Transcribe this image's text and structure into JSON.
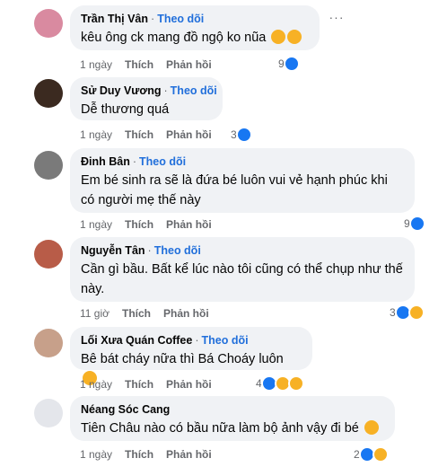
{
  "comments": [
    {
      "name": "Trần Thị Vân",
      "follow": "Theo dõi",
      "text": "kêu ông ck mang đồ ngộ ko nũa",
      "time": "1 ngày",
      "like": "Thích",
      "reply": "Phản hồi",
      "reaction_count": "9",
      "reactions": [
        "like-icon"
      ],
      "text_emojis": [
        "laughing-emoji",
        "laughing-emoji"
      ],
      "avatar_color": "#d98aa0"
    },
    {
      "name": "Sử Duy Vương",
      "follow": "Theo dõi",
      "text": "Dễ thương quá",
      "time": "1 ngày",
      "like": "Thích",
      "reply": "Phản hồi",
      "reaction_count": "3",
      "reactions": [
        "like-icon"
      ],
      "avatar_color": "#3b2a20"
    },
    {
      "name": "Đinh Bân",
      "follow": "Theo dõi",
      "text": "Em bé sinh ra sẽ là đứa bé luôn vui vẻ hạnh phúc khi có người mẹ thế này",
      "time": "1 ngày",
      "like": "Thích",
      "reply": "Phản hồi",
      "reaction_count": "9",
      "reactions": [
        "like-icon"
      ],
      "avatar_color": "#7a7a7a"
    },
    {
      "name": "Nguyễn Tân",
      "follow": "Theo dõi",
      "text": "Cần gì bầu. Bất kể lúc nào tôi cũng có thể chụp như thế này.",
      "time": "11 giờ",
      "like": "Thích",
      "reply": "Phản hồi",
      "reaction_count": "3",
      "reactions": [
        "like-icon",
        "haha-icon"
      ],
      "avatar_color": "#b85c48"
    },
    {
      "name": "Lối Xưa Quán Coffee",
      "follow": "Theo dõi",
      "text": "Bê bát cháy nữa thì Bá Choáy luôn",
      "time": "1 ngày",
      "like": "Thích",
      "reply": "Phản hồi",
      "reaction_count": "4",
      "reactions": [
        "like-icon",
        "haha-icon",
        "wow-icon"
      ],
      "text_emojis": [
        "laughing-emoji"
      ],
      "avatar_color": "#c7a08a"
    },
    {
      "name": "Néang Sóc Cang",
      "follow": "",
      "text": "Tiên Châu nào có bầu nữa làm bộ ảnh vậy đi bé",
      "time": "1 ngày",
      "like": "Thích",
      "reply": "Phản hồi",
      "reaction_count": "2",
      "reactions": [
        "like-icon",
        "haha-icon"
      ],
      "text_emojis": [
        "rofl-emoji"
      ],
      "avatar_color": "#e4e6eb"
    }
  ],
  "colors": {
    "like_blue": "#1877f2",
    "follow_blue": "#216fdb",
    "bubble_bg": "#f0f2f5",
    "meta_gray": "#65676b",
    "emoji_yellow": "#f7b125"
  },
  "more_icon": "more-horizontal-icon"
}
